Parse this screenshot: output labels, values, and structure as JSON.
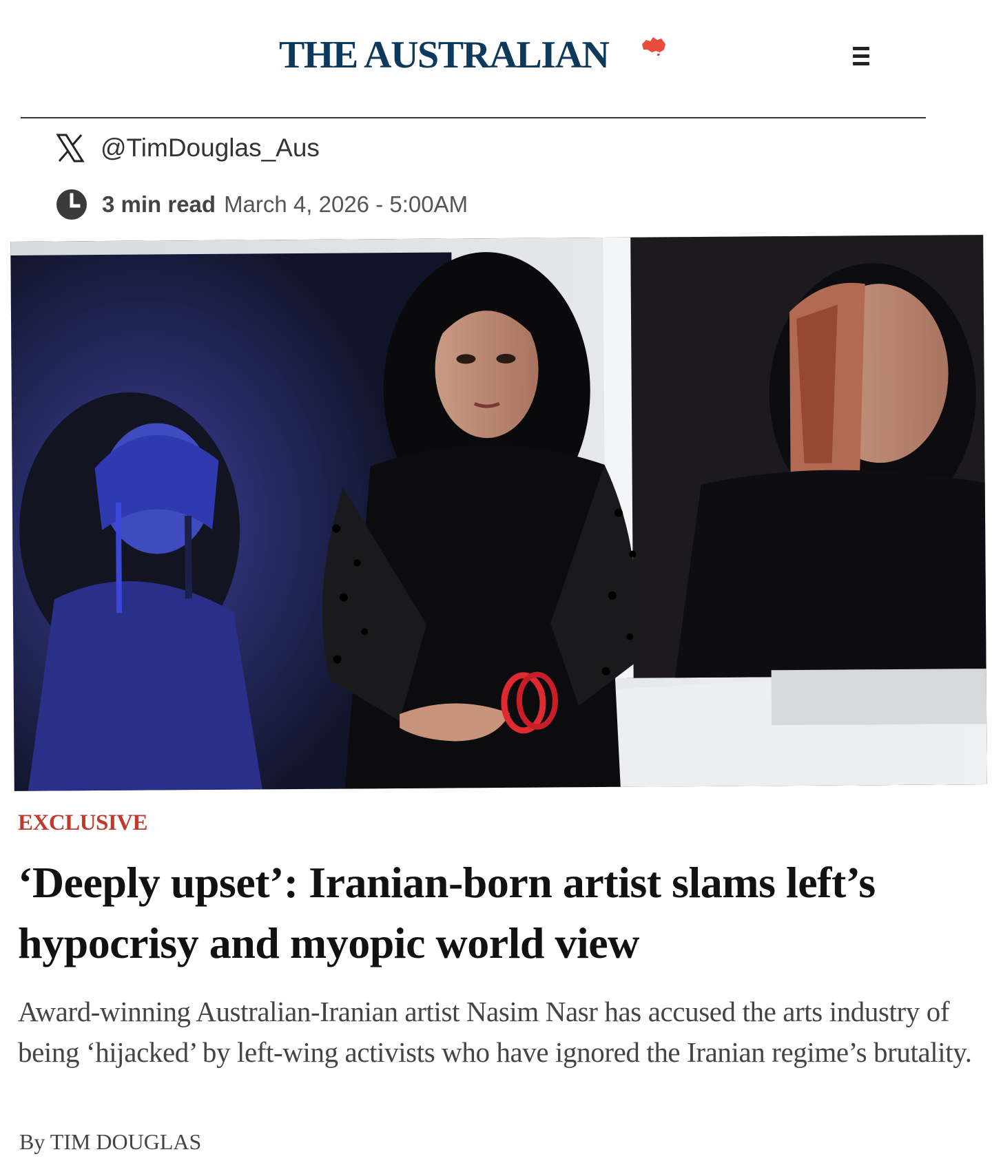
{
  "masthead": {
    "logo_text": "THE AUSTRALIAN",
    "logo_mark": "australia-map-icon",
    "menu_icon": "hamburger-menu-icon",
    "brand_color": "#0d3a5c",
    "mark_color": "#e74c3c"
  },
  "author": {
    "social_icon": "x-icon",
    "handle": "@TimDouglas_Aus"
  },
  "meta": {
    "clock_icon": "clock-icon",
    "read_time": "3 min read",
    "date": "March 4, 2026 - 5:00AM"
  },
  "hero_image": {
    "description_icon": "photo"
  },
  "article": {
    "kicker": "EXCLUSIVE",
    "kicker_color": "#c0392b",
    "headline": "‘Deeply upset’: Iranian-born artist slams left’s hypocrisy and myopic world view",
    "standfirst": "Award-winning Australian-Iranian artist Nasim Nasr has accused the arts industry of being ‘hijacked’ by left-wing activists who have ignored the Iranian regime’s brutality.",
    "byline": "By TIM DOUGLAS"
  }
}
